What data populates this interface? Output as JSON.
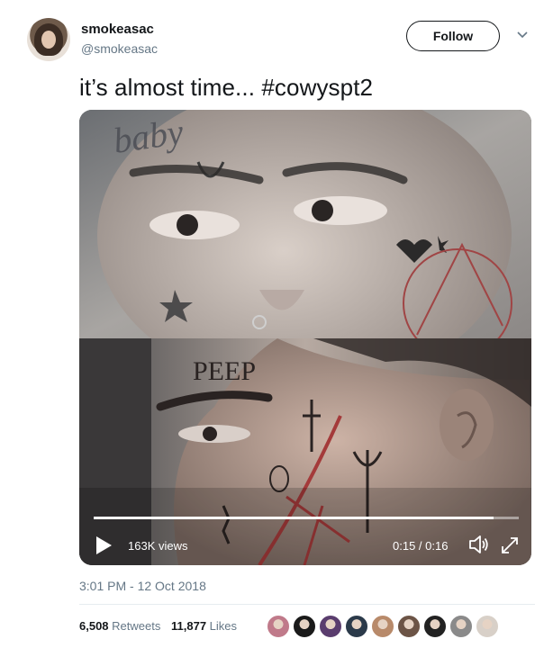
{
  "user": {
    "display_name": "smokeasac",
    "handle": "@smokeasac"
  },
  "follow_label": "Follow",
  "tweet": {
    "text": "it’s almost time... #cowyspt2"
  },
  "video": {
    "views": "163K views",
    "time": "0:15 / 0:16",
    "progress": 0.94,
    "top_tattoo_text": "baby",
    "bottom_tattoo_text": "PEEP"
  },
  "timestamp": "3:01 PM - 12 Oct 2018",
  "stats": {
    "retweets_count": "6,508",
    "retweets_label": "Retweets",
    "likes_count": "11,877",
    "likes_label": "Likes"
  },
  "likers": [
    {
      "name": "liker-1",
      "color": "#c07a8a"
    },
    {
      "name": "liker-2",
      "color": "#1a1a1a"
    },
    {
      "name": "liker-3",
      "color": "#5a3d6e"
    },
    {
      "name": "liker-4",
      "color": "#2b3a4a"
    },
    {
      "name": "liker-5",
      "color": "#b88a6a"
    },
    {
      "name": "liker-6",
      "color": "#6c5446"
    },
    {
      "name": "liker-7",
      "color": "#222222"
    },
    {
      "name": "liker-8",
      "color": "#8a8a8a"
    },
    {
      "name": "liker-9",
      "color": "#d8d0c8"
    }
  ],
  "colors": {
    "text": "#14171a",
    "muted": "#657786",
    "divider": "#e6ecf0"
  }
}
